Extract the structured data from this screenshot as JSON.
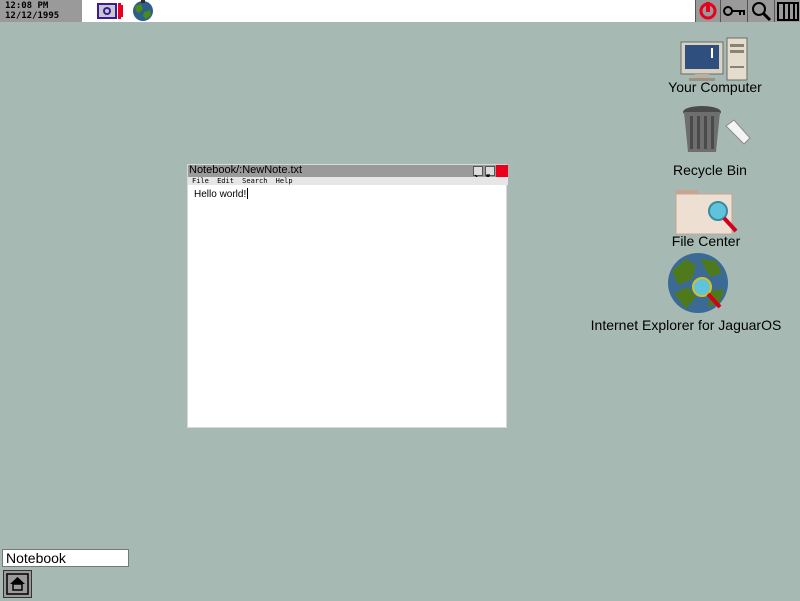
{
  "topbar": {
    "time": "12:08 PM",
    "date": "12/12/1995",
    "tray_left_icons": [
      "camera-icon",
      "globe-icon"
    ],
    "tray_right_icons": [
      "power-icon",
      "key-icon",
      "magnifier-icon",
      "columns-icon"
    ]
  },
  "desktop": {
    "icons": [
      {
        "label": "Your Computer",
        "icon": "computer-icon"
      },
      {
        "label": "Recycle Bin",
        "icon": "trash-icon"
      },
      {
        "label": "File Center",
        "icon": "folder-search-icon"
      },
      {
        "label": "Internet Explorer for JaguarOS",
        "icon": "globe-search-icon"
      }
    ]
  },
  "window": {
    "title": "Notebook/:NewNote.txt",
    "menu": [
      "File",
      "Edit",
      "Search",
      "Help"
    ],
    "content": "Hello world!"
  },
  "taskbar": {
    "active_app": "Notebook",
    "start_icon": "home-up-icon"
  },
  "colors": {
    "desktop": "#a6bab3",
    "titlebar": "#9a9a9a",
    "close": "#e8001c"
  }
}
